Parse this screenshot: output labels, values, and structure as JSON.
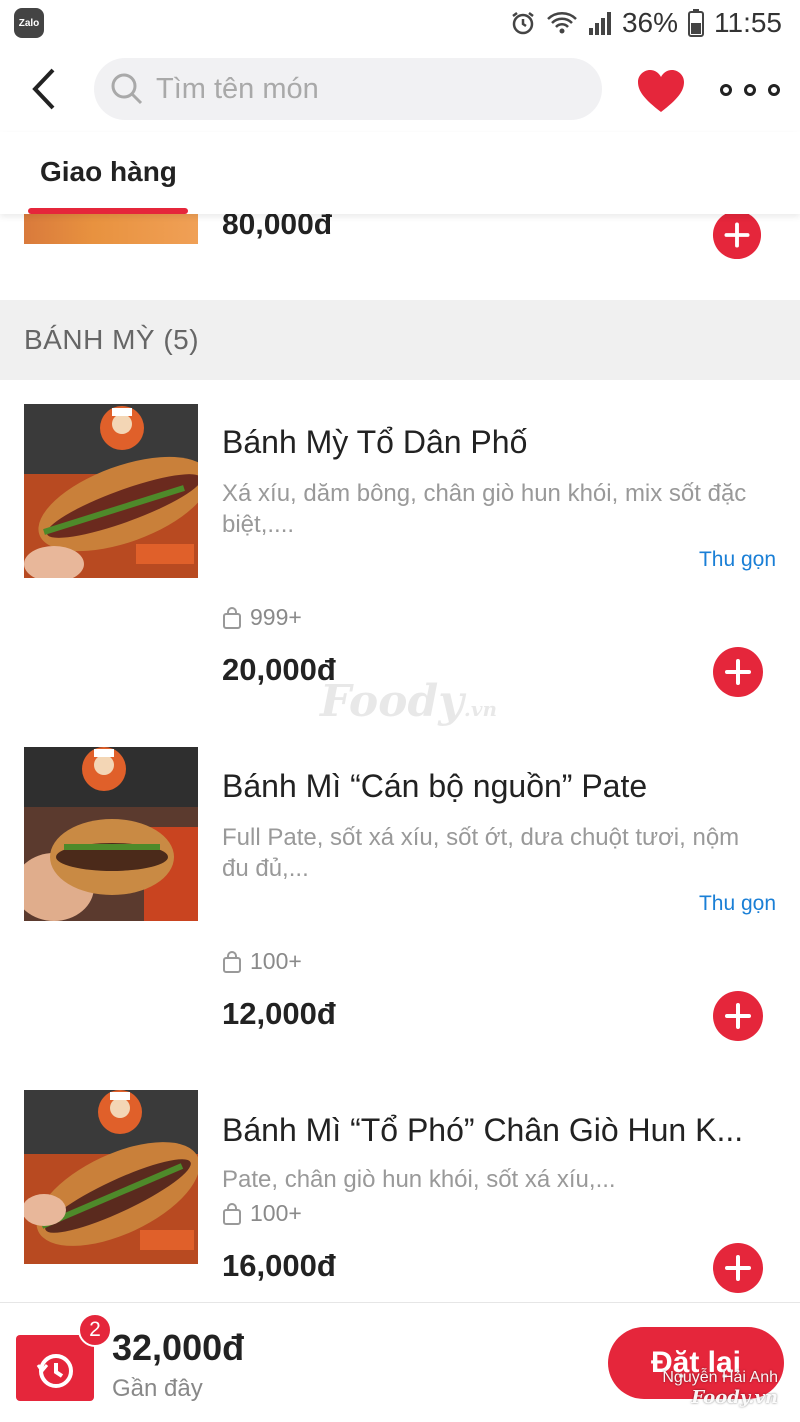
{
  "status_bar": {
    "app_icon_label": "Zalo",
    "battery": "36%",
    "time": "11:55"
  },
  "header": {
    "search_placeholder": "Tìm tên món"
  },
  "tabs": [
    {
      "label": "Giao hàng"
    }
  ],
  "partial_item": {
    "price": "80,000đ"
  },
  "section": {
    "title": "BÁNH MỲ (5)"
  },
  "items": [
    {
      "name": "Bánh Mỳ Tổ Dân Phố",
      "description": "Xá xíu, dăm bông, chân giò hun khói, mix sốt đặc biệt,....",
      "collapse_label": "Thu gọn",
      "sold": "999+",
      "price": "20,000đ"
    },
    {
      "name": "Bánh Mì “Cán bộ nguồn” Pate",
      "description": "Full Pate, sốt xá xíu, sốt ớt, dưa chuột tươi, nộm đu đủ,...",
      "collapse_label": "Thu gọn",
      "sold": "100+",
      "price": "12,000đ"
    },
    {
      "name": "Bánh Mì “Tổ Phó” Chân Giò Hun K...",
      "description": "Pate, chân giò hun khói, sốt xá xíu,...",
      "sold": "100+",
      "price": "16,000đ"
    }
  ],
  "watermark": {
    "brand": "Foody",
    "suffix": ".vn"
  },
  "bottom_bar": {
    "cart_count": "2",
    "total": "32,000đ",
    "recent_label": "Gần đây",
    "reorder_label": "Đặt lại"
  },
  "credit": {
    "author": "Nguyễn Hải Anh",
    "brand": "Foody.vn"
  },
  "colors": {
    "accent": "#e5263b",
    "link": "#1a7fd6",
    "section_bg": "#f0f0f0"
  }
}
